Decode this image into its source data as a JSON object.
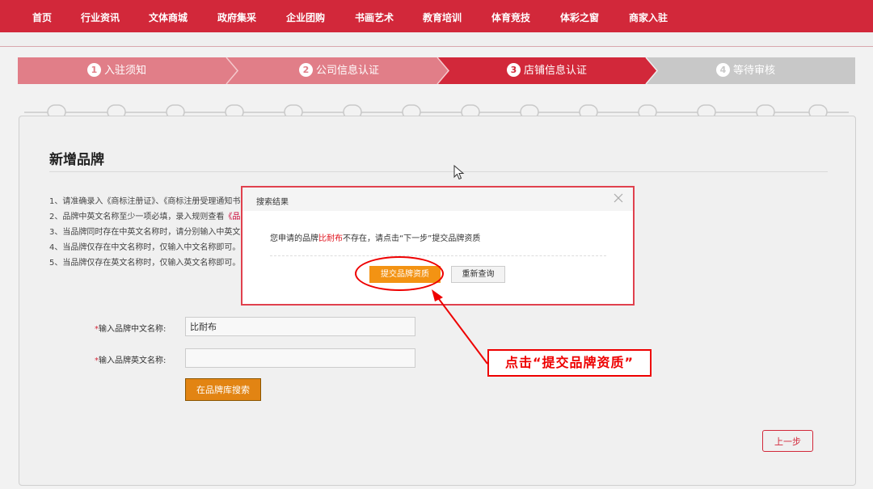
{
  "nav": {
    "items": [
      "首页",
      "行业资讯",
      "文体商城",
      "政府集采",
      "企业团购",
      "书画艺术",
      "教育培训",
      "体育竞技",
      "体彩之窗",
      "商家入驻"
    ]
  },
  "steps": [
    {
      "num": "1",
      "label": "入驻须知"
    },
    {
      "num": "2",
      "label": "公司信息认证"
    },
    {
      "num": "3",
      "label": "店铺信息认证"
    },
    {
      "num": "4",
      "label": "等待审核"
    }
  ],
  "current_step": 3,
  "page": {
    "title": "新增品牌",
    "rules": [
      {
        "text": "1、请准确录入《商标注册证》、《商标注册受理通知书",
        "link": ""
      },
      {
        "text": "2、品牌中英文名称至少一项必填，录入规则查看",
        "link": "《品"
      },
      {
        "text": "3、当品牌同时存在中英文名称时，请分别输入中英文",
        "link": ""
      },
      {
        "text": "4、当品牌仅存在中文名称时，仅输入中文名称即可。",
        "link": ""
      },
      {
        "text": "5、当品牌仅存在英文名称时，仅输入英文名称即可。",
        "link": ""
      }
    ]
  },
  "form": {
    "cn_label_star": "*",
    "cn_label": "输入品牌中文名称:",
    "cn_value": "比耐布",
    "en_label_star": "*",
    "en_label": "输入品牌英文名称:",
    "en_value": "",
    "search_button": "在品牌库搜索",
    "prev_button": "上一步"
  },
  "modal": {
    "title": "搜索结果",
    "msg_prefix": "您申请的品牌",
    "brand": "比耐布",
    "msg_suffix": "不存在，请点击“下一步”提交品牌资质",
    "submit_button": "提交品牌资质",
    "requery_button": "重新查询"
  },
  "annotation": {
    "text": "点击“提交品牌资质”"
  },
  "colors": {
    "brand_red": "#d2283a",
    "step_done": "#e17e88",
    "step_active": "#d2283a",
    "step_todo": "#c8c8c8",
    "orange": "#f39313",
    "annotation_red": "#ee0000"
  }
}
